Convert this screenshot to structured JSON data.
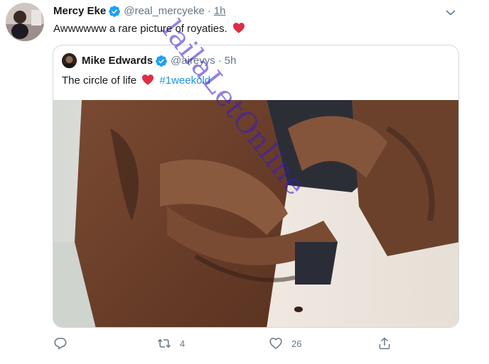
{
  "tweet": {
    "author_name": "Mercy Eke",
    "author_handle": "@real_mercyeke",
    "separator": "·",
    "time": "1h",
    "text": "Awwwwww a rare picture of royaties.",
    "text_emoji": "heart-emoji"
  },
  "quoted_tweet": {
    "author_name": "Mike Edwards",
    "author_handle": "@aireyys",
    "separator": "·",
    "time": "5h",
    "text": "The circle of life",
    "text_emoji": "heart-emoji",
    "hashtag": "#1weekold"
  },
  "actions": {
    "reply_icon": "reply-icon",
    "retweet_icon": "retweet-icon",
    "retweet_count": "4",
    "like_icon": "heart-outline-icon",
    "like_count": "26",
    "share_icon": "share-icon"
  },
  "watermark": "lailaLetOnline",
  "colors": {
    "verified_blue": "#1da1f2",
    "heart_red": "#e0245e",
    "secondary_text": "#657786",
    "hashtag_blue": "#1b95e0",
    "border": "#cfd9de",
    "watermark": "#3719c8"
  }
}
